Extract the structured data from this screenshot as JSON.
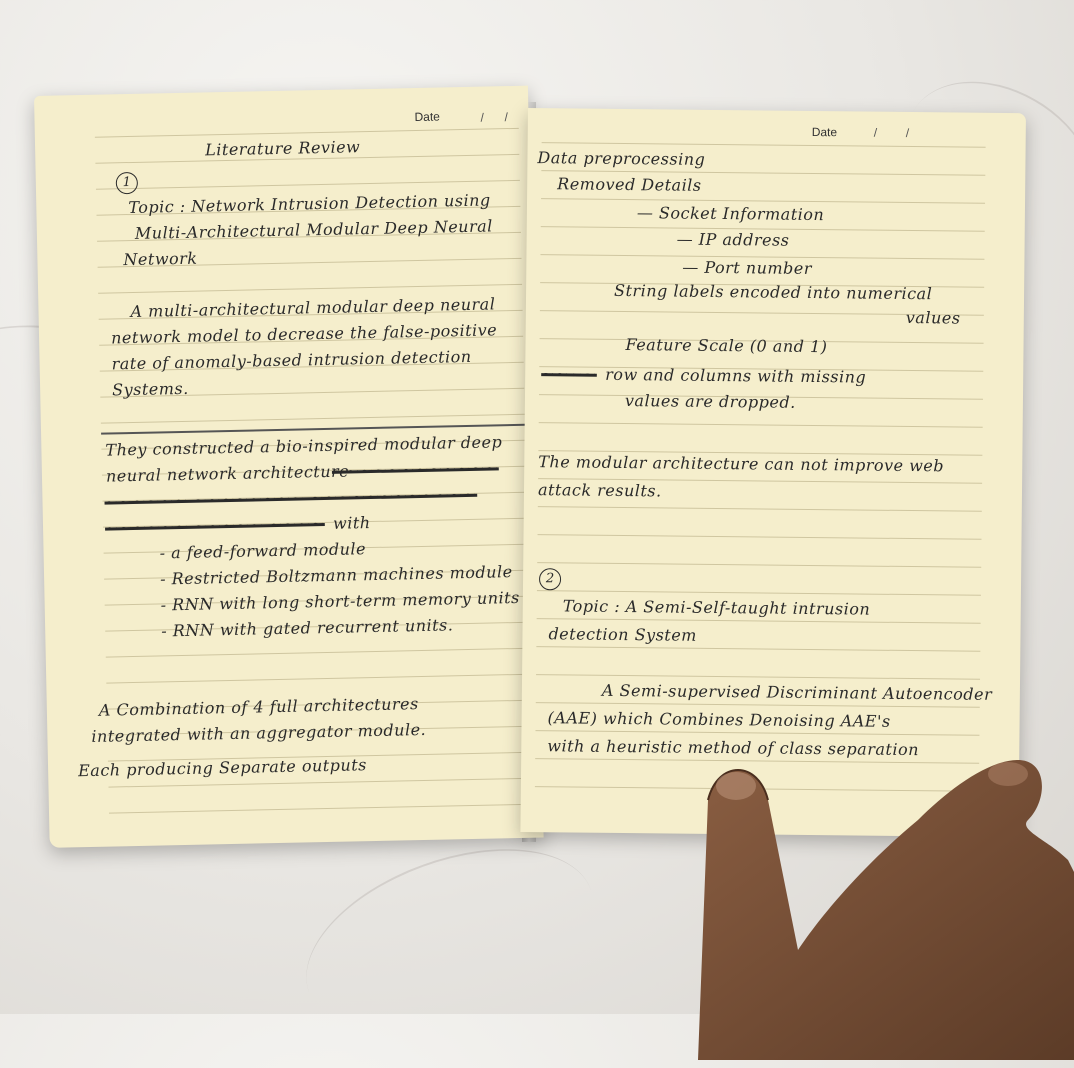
{
  "left_page": {
    "date_label": "Date",
    "title": "Literature Review",
    "number": "1",
    "topic_lines": [
      "Topic : Network Intrusion Detection using",
      "Multi-Architectural Modular Deep Neural",
      "Network"
    ],
    "summary_lines": [
      "A multi-architectural modular deep neural",
      "network model to decrease the false-positive",
      "rate of anomaly-based intrusion detection",
      "Systems."
    ],
    "body_lines": [
      "They constructed a bio-inspired modular deep",
      "neural network architecture",
      "with"
    ],
    "bullets": [
      "- a feed-forward module",
      "- Restricted Boltzmann machines module",
      "- RNN with long short-term memory units",
      "- RNN with gated recurrent units."
    ],
    "closing_lines": [
      "A Combination of 4 full architectures",
      "integrated with an aggregator module.",
      "Each producing Separate outputs"
    ]
  },
  "right_page": {
    "date_label": "Date",
    "preprocessing_lines": [
      "Data preprocessing",
      "Removed Details",
      "— Socket Information",
      "— IP address",
      "— Port number",
      "String labels encoded into numerical",
      "values",
      "Feature Scale (0 and 1)",
      "row and columns with missing",
      "values are dropped."
    ],
    "note_lines": [
      "The modular architecture can not improve web",
      "attack results."
    ],
    "number": "2",
    "topic_lines": [
      "Topic : A Semi-Self-taught intrusion",
      "detection System"
    ],
    "summary_lines": [
      "A Semi-supervised Discriminant Autoencoder",
      "(AAE) which Combines Denoising AAE's",
      "with a heuristic method of class separation"
    ]
  }
}
